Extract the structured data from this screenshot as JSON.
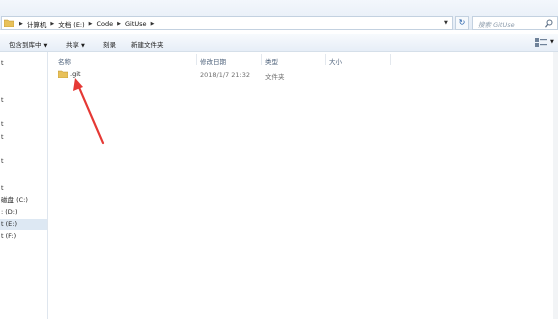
{
  "address_bar": {
    "crumbs": [
      "计算机",
      "文档 (E:)",
      "Code",
      "GitUse"
    ],
    "search_placeholder": "搜索 GitUse"
  },
  "toolbar": {
    "include_in_library": "包含到库中",
    "share": "共享",
    "burn": "刻录",
    "new_folder": "新建文件夹"
  },
  "columns": {
    "name": "名称",
    "date_modified": "修改日期",
    "type": "类型",
    "size": "大小"
  },
  "files": [
    {
      "name": ".git",
      "date_modified": "2018/1/7 21:32",
      "type": "文件夹",
      "size": ""
    }
  ],
  "nav": {
    "items": [
      "磁盘 (C:)",
      ": (D:)",
      "t (E:)",
      "t (F:)"
    ],
    "selected_index": 2,
    "fragments": [
      "t",
      "t",
      "t",
      "t",
      "t",
      "t"
    ]
  },
  "colors": {
    "folder": "#e8c15a",
    "arrow": "#e53935",
    "selection": "#dde8f3"
  },
  "icons": {
    "address_folder": "folder-icon",
    "refresh": "refresh-icon",
    "search": "search-icon",
    "view": "view-options-icon",
    "file": "folder-icon"
  }
}
